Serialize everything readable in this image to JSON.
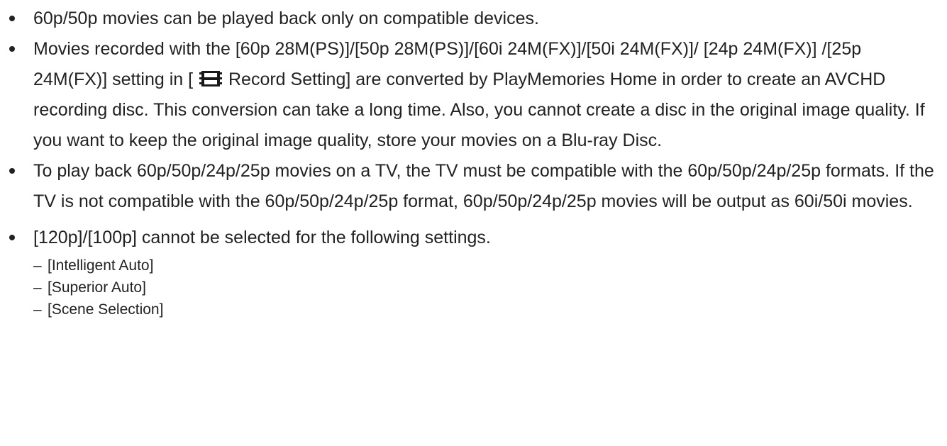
{
  "notes": [
    {
      "text": "60p/50p movies can be played back only on compatible devices."
    },
    {
      "text_before_icon": "Movies recorded with the [60p 28M(PS)]/[50p 28M(PS)]/[60i 24M(FX)]/[50i 24M(FX)]/ [24p 24M(FX)] /[25p 24M(FX)] setting in [",
      "icon": "movie-film-icon",
      "text_after_icon": "Record Setting] are converted by PlayMemories Home in order to create an AVCHD recording disc. This conversion can take a long time. Also, you cannot create a disc in the original image quality. If you want to keep the original image quality, store your movies on a Blu-ray Disc."
    },
    {
      "text": "To play back 60p/50p/24p/25p movies on a TV, the TV must be compatible with the 60p/50p/24p/25p formats. If the TV is not compatible with the 60p/50p/24p/25p format, 60p/50p/24p/25p movies will be output as 60i/50i movies."
    },
    {
      "text": "[120p]/[100p] cannot be selected for the following settings.",
      "sub_items": [
        {
          "dash": "–",
          "text": "[Intelligent Auto]"
        },
        {
          "dash": "–",
          "text": "[Superior Auto]"
        },
        {
          "dash": "–",
          "text": "[Scene Selection]"
        }
      ]
    }
  ]
}
